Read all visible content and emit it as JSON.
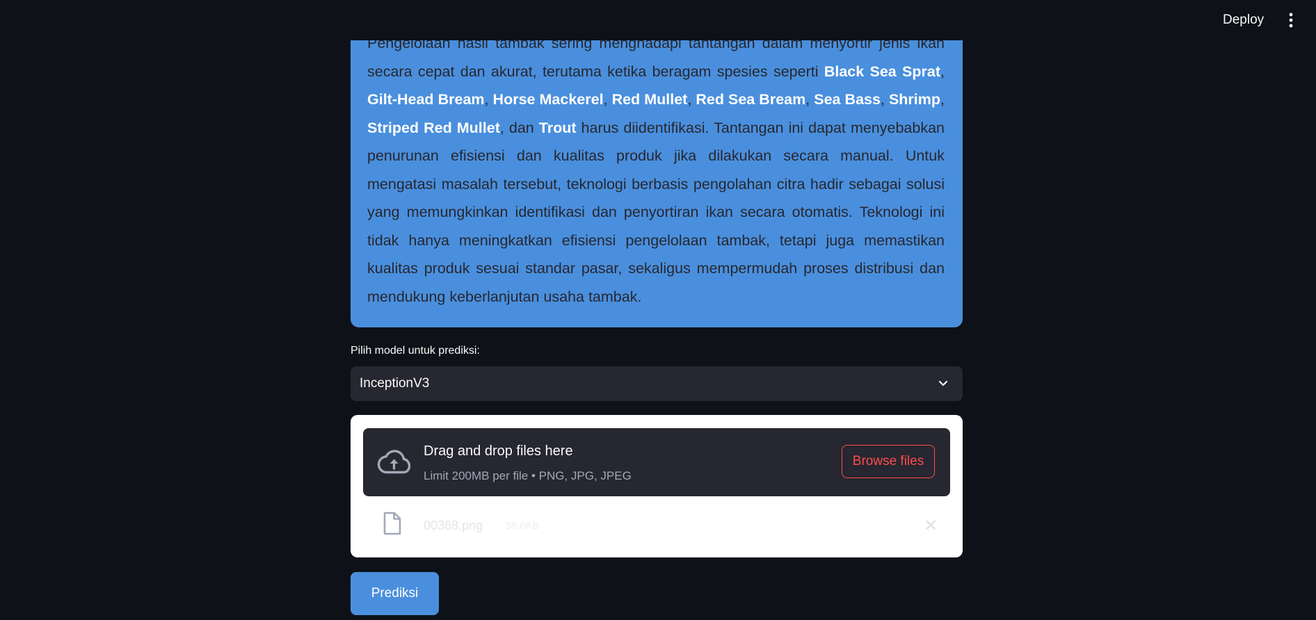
{
  "header": {
    "deploy_label": "Deploy",
    "menu_icon": "vertical-dots-icon"
  },
  "intro": {
    "segments": [
      {
        "text": "Pengelolaan hasil tambak sering menghadapi tantangan dalam menyortir jenis ikan secara cepat dan akurat, terutama ketika beragam spesies seperti ",
        "bold": false
      },
      {
        "text": "Black Sea Sprat",
        "bold": true
      },
      {
        "text": ", ",
        "bold": false
      },
      {
        "text": "Gilt-Head Bream",
        "bold": true
      },
      {
        "text": ", ",
        "bold": false
      },
      {
        "text": "Horse Mackerel",
        "bold": true
      },
      {
        "text": ", ",
        "bold": false
      },
      {
        "text": "Red Mullet",
        "bold": true
      },
      {
        "text": ", ",
        "bold": false
      },
      {
        "text": "Red Sea Bream",
        "bold": true
      },
      {
        "text": ", ",
        "bold": false
      },
      {
        "text": "Sea Bass",
        "bold": true
      },
      {
        "text": ", ",
        "bold": false
      },
      {
        "text": "Shrimp",
        "bold": true
      },
      {
        "text": ", ",
        "bold": false
      },
      {
        "text": "Striped Red Mullet",
        "bold": true
      },
      {
        "text": ", dan ",
        "bold": false
      },
      {
        "text": "Trout",
        "bold": true
      },
      {
        "text": " harus diidentifikasi. Tantangan ini dapat menyebabkan penurunan efisiensi dan kualitas produk jika dilakukan secara manual. Untuk mengatasi masalah tersebut, teknologi berbasis pengolahan citra hadir sebagai solusi yang memungkinkan identifikasi dan penyortiran ikan secara otomatis. Teknologi ini tidak hanya meningkatkan efisiensi pengelolaan tambak, tetapi juga memastikan kualitas produk sesuai standar pasar, sekaligus mempermudah proses distribusi dan mendukung keberlanjutan usaha tambak.",
        "bold": false
      }
    ],
    "background_color": "#4a8fdd"
  },
  "model_select": {
    "label": "Pilih model untuk prediksi:",
    "selected": "InceptionV3",
    "icon": "chevron-down-icon"
  },
  "uploader": {
    "title": "Drag and drop files here",
    "limit": "Limit 200MB per file • PNG, JPG, JPEG",
    "browse_label": "Browse files",
    "upload_icon": "cloud-upload-icon",
    "file": {
      "name": "00368.png",
      "size": "36.6KB",
      "icon": "file-icon",
      "remove_icon": "close-icon"
    }
  },
  "predict_button": {
    "label": "Prediksi"
  },
  "colors": {
    "background": "#0e1117",
    "accent_blue": "#4a8fdd",
    "browse_red": "#ff4b4b",
    "widget_dark": "#262730"
  }
}
